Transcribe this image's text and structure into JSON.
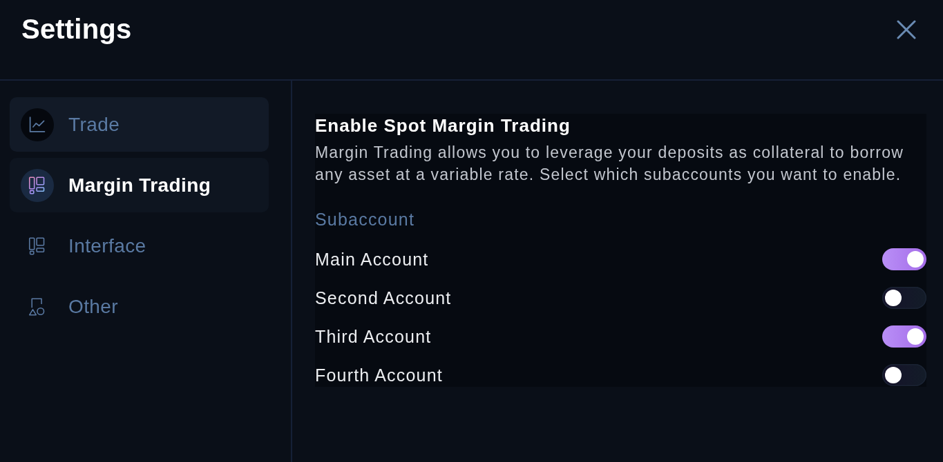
{
  "header": {
    "title": "Settings"
  },
  "sidebar": {
    "items": [
      {
        "label": "Trade",
        "selected": false,
        "hovered": true
      },
      {
        "label": "Margin Trading",
        "selected": true,
        "hovered": false
      },
      {
        "label": "Interface",
        "selected": false,
        "hovered": false
      },
      {
        "label": "Other",
        "selected": false,
        "hovered": false
      }
    ]
  },
  "panel": {
    "title": "Enable Spot Margin Trading",
    "description": "Margin Trading allows you to leverage your deposits as collateral to borrow any asset at a variable rate. Select which subaccounts you want to enable.",
    "section_label": "Subaccount",
    "accounts": [
      {
        "name": "Main Account",
        "on": true
      },
      {
        "name": "Second Account",
        "on": false
      },
      {
        "name": "Third Account",
        "on": true
      },
      {
        "name": "Fourth Account",
        "on": false
      }
    ]
  }
}
